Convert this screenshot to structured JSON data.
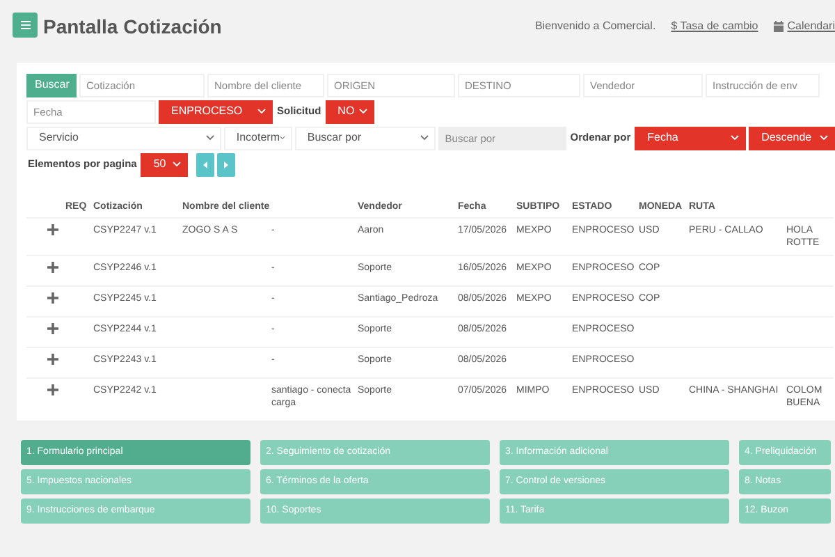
{
  "header": {
    "title": "Pantalla Cotización",
    "welcome": "Bienvenido a Comercial.",
    "links": [
      {
        "label": "$ Tasa de cambio",
        "kind": "plain"
      },
      {
        "label": "Calendari",
        "kind": "calendar"
      }
    ]
  },
  "filter_rows": [
    [
      {
        "kind": "button",
        "label": "Buscar"
      },
      {
        "kind": "input",
        "placeholder": "Cotización",
        "disabled": false
      },
      {
        "kind": "input",
        "placeholder": "Nombre del cliente",
        "disabled": false
      },
      {
        "kind": "input",
        "placeholder": "ORIGEN",
        "disabled": false
      },
      {
        "kind": "input",
        "placeholder": "DESTINO",
        "disabled": false
      },
      {
        "kind": "input",
        "placeholder": "Vendedor",
        "disabled": false
      },
      {
        "kind": "input",
        "placeholder": "Instrucción de env",
        "disabled": false
      }
    ],
    [
      {
        "kind": "input",
        "placeholder": "Fecha",
        "disabled": false
      },
      {
        "kind": "select",
        "value": "ENPROCESO",
        "highlighted": true
      },
      {
        "kind": "label",
        "text": "Solicitud"
      },
      {
        "kind": "select",
        "value": "NO",
        "highlighted": true
      }
    ],
    [
      {
        "kind": "select",
        "value": "Servicio",
        "highlighted": false
      },
      {
        "kind": "select",
        "value": "Incoterm",
        "highlighted": false
      },
      {
        "kind": "select",
        "value": "Buscar por",
        "highlighted": false
      },
      {
        "kind": "input",
        "placeholder": "Buscar por",
        "disabled": true
      },
      {
        "kind": "label",
        "text": "Ordenar por"
      },
      {
        "kind": "select",
        "value": "Fecha",
        "highlighted": true
      },
      {
        "kind": "select",
        "value": "Descende",
        "highlighted": true
      }
    ],
    [
      {
        "kind": "label",
        "text": "Elementos por pagina"
      },
      {
        "kind": "select",
        "value": "50",
        "highlighted": true
      },
      {
        "kind": "prev"
      },
      {
        "kind": "next"
      }
    ]
  ],
  "table": {
    "columns": [
      "REQ",
      "Cotización",
      "Nombre del cliente",
      "Vendedor",
      "Fecha",
      "SUBTIPO",
      "ESTADO",
      "MONEDA",
      "RUTA"
    ],
    "rows": [
      {
        "cotizacion": "CSYP2247 v.1",
        "cliente": "ZOGO S A S",
        "column_4": "-",
        "vendedor": "Aaron",
        "fecha": "17/05/2026",
        "subtipo": "MEXPO",
        "estado": "ENPROCESO",
        "moneda": "USD",
        "ruta": "PERU - CALLAO",
        "column_12": "HOLA ROTTE"
      },
      {
        "cotizacion": "CSYP2246 v.1",
        "column_4": "-",
        "vendedor": "Soporte",
        "fecha": "16/05/2026",
        "subtipo": "MEXPO",
        "estado": "ENPROCESO",
        "moneda": "COP"
      },
      {
        "cotizacion": "CSYP2245 v.1",
        "column_4": "-",
        "vendedor": "Santiago_Pedroza",
        "fecha": "08/05/2026",
        "subtipo": "MEXPO",
        "estado": "ENPROCESO",
        "moneda": "COP"
      },
      {
        "cotizacion": "CSYP2244 v.1",
        "column_4": "-",
        "vendedor": "Soporte",
        "fecha": "08/05/2026",
        "estado": "ENPROCESO"
      },
      {
        "cotizacion": "CSYP2243 v.1",
        "column_4": "-",
        "vendedor": "Soporte",
        "fecha": "08/05/2026",
        "estado": "ENPROCESO"
      },
      {
        "cotizacion": "CSYP2242 v.1",
        "column_4": "santiago - conecta carga",
        "vendedor": "Soporte",
        "fecha": "07/05/2026",
        "subtipo": "MIMPO",
        "estado": "ENPROCESO",
        "moneda": "USD",
        "ruta": "CHINA - SHANGHAI",
        "column_12": "COLOM BUENA"
      }
    ]
  },
  "tabs": [
    {
      "label": "1. Formulario principal",
      "selected": true
    },
    {
      "label": "2. Seguimiento de cotización",
      "selected": false
    },
    {
      "label": "3. Información adicional",
      "selected": false
    },
    {
      "label": "4. Preliquidación",
      "selected": false
    },
    {
      "label": "5. Impuestos nacionales",
      "selected": false
    },
    {
      "label": "6. Términos de la oferta",
      "selected": false
    },
    {
      "label": "7. Control de versiones",
      "selected": false
    },
    {
      "label": "8. Notas",
      "selected": false
    },
    {
      "label": "9. Instrucciones de embarque",
      "selected": false
    },
    {
      "label": "10. Soportes",
      "selected": false
    },
    {
      "label": "11. Tarifa",
      "selected": false
    },
    {
      "label": "12. Buzon",
      "selected": false
    }
  ]
}
